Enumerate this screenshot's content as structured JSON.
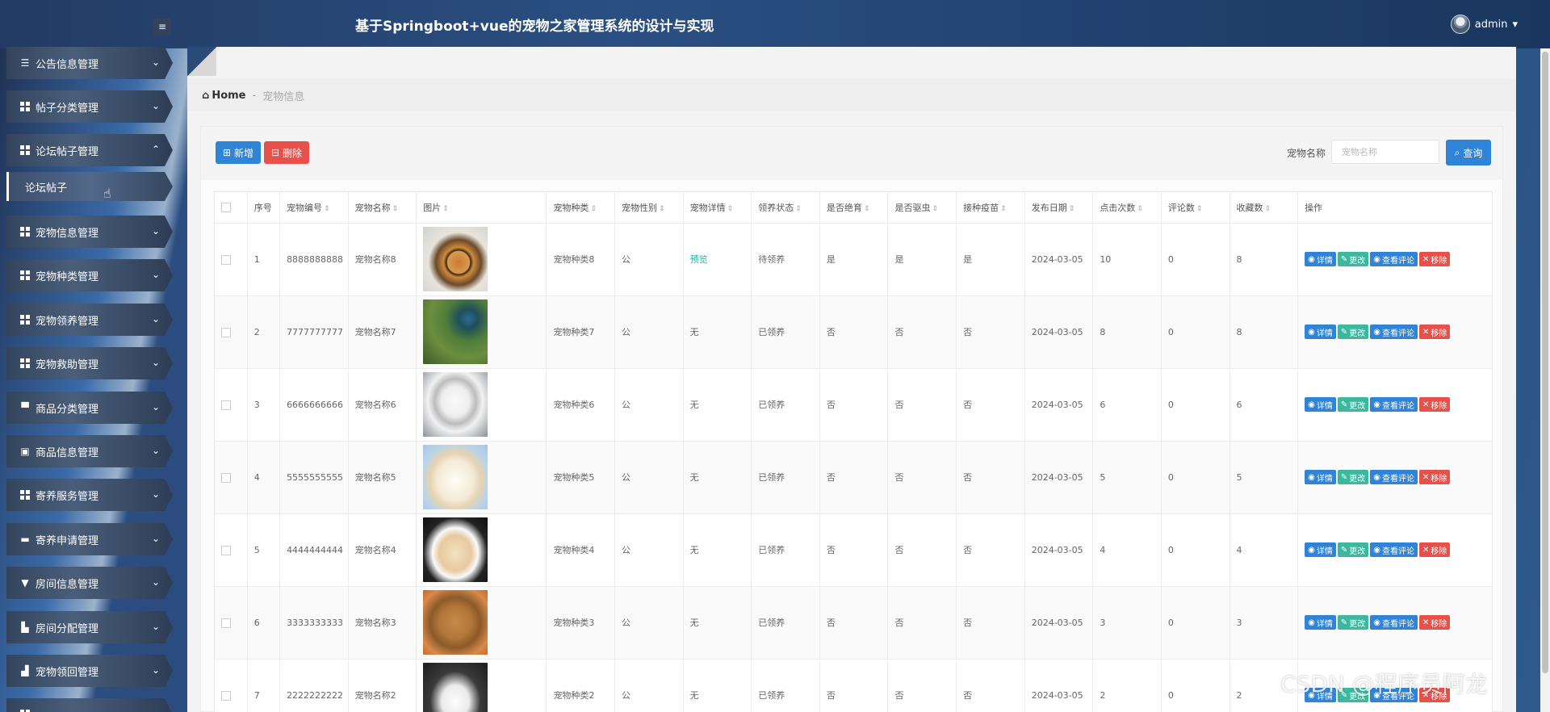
{
  "header": {
    "title": "基于Springboot+vue的宠物之家管理系统的设计与实现",
    "username": "admin",
    "menu_toggle_icon": "menu-fold-icon"
  },
  "sidebar": {
    "items": [
      {
        "label": "公告信息管理",
        "icon": "sliders-icon",
        "expanded": false
      },
      {
        "label": "帖子分类管理",
        "icon": "grid-icon",
        "expanded": false
      },
      {
        "label": "论坛帖子管理",
        "icon": "grid-icon",
        "expanded": true
      },
      {
        "label": "宠物信息管理",
        "icon": "grid-icon",
        "expanded": false
      },
      {
        "label": "宠物种类管理",
        "icon": "grid-icon",
        "expanded": false
      },
      {
        "label": "宠物领养管理",
        "icon": "grid-icon",
        "expanded": false
      },
      {
        "label": "宠物救助管理",
        "icon": "grid-icon",
        "expanded": false
      },
      {
        "label": "商品分类管理",
        "icon": "briefcase-icon",
        "expanded": false
      },
      {
        "label": "商品信息管理",
        "icon": "clipboard-icon",
        "expanded": false
      },
      {
        "label": "寄养服务管理",
        "icon": "grid-icon",
        "expanded": false
      },
      {
        "label": "寄养申请管理",
        "icon": "monitor-icon",
        "expanded": false
      },
      {
        "label": "房间信息管理",
        "icon": "sign-icon",
        "expanded": false
      },
      {
        "label": "房间分配管理",
        "icon": "mailbox-icon",
        "expanded": false
      },
      {
        "label": "宠物领回管理",
        "icon": "bar-chart-icon",
        "expanded": false
      }
    ],
    "submenu": {
      "label": "论坛帖子"
    }
  },
  "breadcrumb": {
    "home": "Home",
    "separator": "-",
    "current": "宠物信息"
  },
  "toolbar": {
    "add_label": "新增",
    "delete_label": "删除",
    "search_label": "宠物名称",
    "search_placeholder": "宠物名称",
    "search_button": "查询"
  },
  "table": {
    "headers": [
      "序号",
      "宠物编号",
      "宠物名称",
      "图片",
      "宠物种类",
      "宠物性别",
      "宠物详情",
      "领养状态",
      "是否绝育",
      "是否驱虫",
      "接种疫苗",
      "发布日期",
      "点击次数",
      "评论数",
      "收藏数",
      "操作"
    ],
    "actions": {
      "detail": "详情",
      "edit": "更改",
      "comments": "查看评论",
      "remove": "移除"
    },
    "rows": [
      {
        "no": "1",
        "code": "8888888888",
        "name": "宠物名称8",
        "image": "tiger",
        "kind": "宠物种类8",
        "gender": "公",
        "detail": "预览",
        "status": "待领养",
        "neutered": "是",
        "dewormed": "是",
        "vaccinated": "是",
        "date": "2024-03-05",
        "clicks": "10",
        "comments": "0",
        "favorites": "8"
      },
      {
        "no": "2",
        "code": "7777777777",
        "name": "宠物名称7",
        "image": "peacock",
        "kind": "宠物种类7",
        "gender": "公",
        "detail": "无",
        "status": "已领养",
        "neutered": "否",
        "dewormed": "否",
        "vaccinated": "否",
        "date": "2024-03-05",
        "clicks": "8",
        "comments": "0",
        "favorites": "8"
      },
      {
        "no": "3",
        "code": "6666666666",
        "name": "宠物名称6",
        "image": "bulldog",
        "kind": "宠物种类6",
        "gender": "公",
        "detail": "无",
        "status": "已领养",
        "neutered": "否",
        "dewormed": "否",
        "vaccinated": "否",
        "date": "2024-03-05",
        "clicks": "6",
        "comments": "0",
        "favorites": "6"
      },
      {
        "no": "4",
        "code": "5555555555",
        "name": "宠物名称5",
        "image": "pomeranian",
        "kind": "宠物种类5",
        "gender": "公",
        "detail": "无",
        "status": "已领养",
        "neutered": "否",
        "dewormed": "否",
        "vaccinated": "否",
        "date": "2024-03-05",
        "clicks": "5",
        "comments": "0",
        "favorites": "5"
      },
      {
        "no": "5",
        "code": "4444444444",
        "name": "宠物名称4",
        "image": "puppy",
        "kind": "宠物种类4",
        "gender": "公",
        "detail": "无",
        "status": "已领养",
        "neutered": "否",
        "dewormed": "否",
        "vaccinated": "否",
        "date": "2024-03-05",
        "clicks": "4",
        "comments": "0",
        "favorites": "4"
      },
      {
        "no": "6",
        "code": "3333333333",
        "name": "宠物名称3",
        "image": "lynx",
        "kind": "宠物种类3",
        "gender": "公",
        "detail": "无",
        "status": "已领养",
        "neutered": "否",
        "dewormed": "否",
        "vaccinated": "否",
        "date": "2024-03-05",
        "clicks": "3",
        "comments": "0",
        "favorites": "3"
      },
      {
        "no": "7",
        "code": "2222222222",
        "name": "宠物名称2",
        "image": "polar-bear",
        "kind": "宠物种类2",
        "gender": "公",
        "detail": "无",
        "status": "已领养",
        "neutered": "否",
        "dewormed": "否",
        "vaccinated": "否",
        "date": "2024-03-05",
        "clicks": "2",
        "comments": "0",
        "favorites": "2"
      }
    ]
  },
  "watermark": "CSDN @程序员阿龙"
}
